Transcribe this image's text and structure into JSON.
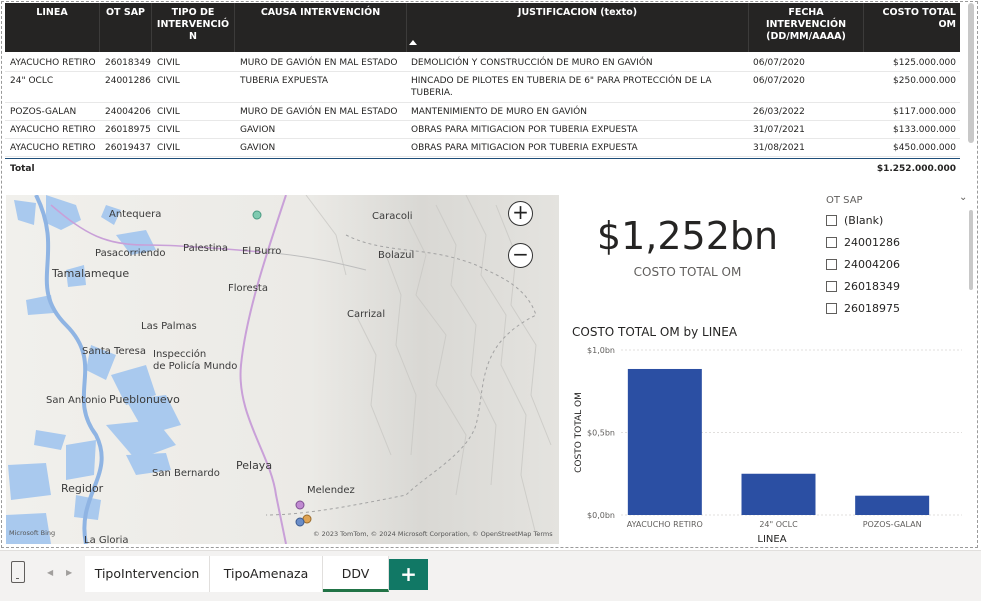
{
  "table": {
    "headers": [
      "LINEA",
      "OT SAP",
      "TIPO DE INTERVENCIÓN",
      "CAUSA INTERVENCIÓN",
      "JUSTIFICACION (texto)",
      "FECHA INTERVENCIÓN (DD/MM/AAAA)",
      "COSTO TOTAL OM"
    ],
    "header_tipo_lines": [
      "TIPO DE",
      "INTERVENCIÓ",
      "N"
    ],
    "header_fecha_lines": [
      "FECHA",
      "INTERVENCIÓN",
      "(DD/MM/AAAA)"
    ],
    "rows": [
      {
        "linea": "AYACUCHO RETIRO",
        "ot": "26018349",
        "tipo": "CIVIL",
        "causa": "MURO DE GAVIÓN EN MAL ESTADO",
        "just": "DEMOLICIÓN Y CONSTRUCCIÓN DE MURO EN GAVIÓN",
        "fecha": "06/07/2020",
        "costo": "$125.000.000"
      },
      {
        "linea": "24\" OCLC",
        "ot": "24001286",
        "tipo": "CIVIL",
        "causa": "TUBERIA EXPUESTA",
        "just": "HINCADO DE PILOTES EN TUBERIA DE 6\" PARA PROTECCIÓN DE LA TUBERIA.",
        "fecha": "06/07/2020",
        "costo": "$250.000.000"
      },
      {
        "linea": "POZOS-GALAN",
        "ot": "24004206",
        "tipo": "CIVIL",
        "causa": "MURO DE GAVIÓN EN MAL ESTADO",
        "just": "MANTENIMIENTO DE MURO EN GAVIÓN",
        "fecha": "26/03/2022",
        "costo": "$117.000.000"
      },
      {
        "linea": "AYACUCHO RETIRO",
        "ot": "26018975",
        "tipo": "CIVIL",
        "causa": "GAVION",
        "just": "OBRAS PARA MITIGACION POR TUBERIA EXPUESTA",
        "fecha": "31/07/2021",
        "costo": "$133.000.000"
      },
      {
        "linea": "AYACUCHO RETIRO",
        "ot": "26019437",
        "tipo": "CIVIL",
        "causa": "GAVION",
        "just": "OBRAS PARA MITIGACION POR TUBERIA EXPUESTA",
        "fecha": "31/08/2021",
        "costo": "$450.000.000"
      }
    ],
    "total_label": "Total",
    "total_value": "$1.252.000.000"
  },
  "map": {
    "labels": [
      "Antequera",
      "Caracoli",
      "Pasacorriendo",
      "Palestina",
      "El Burro",
      "Bolazul",
      "Tamalameque",
      "Floresta",
      "Carrizal",
      "Las Palmas",
      "Santa Teresa",
      "Inspección",
      "de Policía Mundo",
      "San Antonio",
      "Pueblonuevo",
      "San Bernardo",
      "Pelaya",
      "Regidor",
      "Melendez",
      "La Gloria"
    ],
    "zoom_in": "+",
    "zoom_out": "−",
    "credits": "© 2023 TomTom, © 2024 Microsoft Corporation, © OpenStreetMap   Terms",
    "logo": "Microsoft Bing"
  },
  "card": {
    "value": "$1,252bn",
    "label": "COSTO TOTAL OM"
  },
  "slicer": {
    "title": "OT SAP",
    "items": [
      "(Blank)",
      "24001286",
      "24004206",
      "26018349",
      "26018975"
    ]
  },
  "chart_data": {
    "type": "bar",
    "title": "COSTO TOTAL OM by LINEA",
    "xlabel": "LINEA",
    "ylabel": "COSTO TOTAL OM",
    "categories": [
      "AYACUCHO RETIRO",
      "24\" OCLC",
      "POZOS-GALAN"
    ],
    "values": [
      0.885,
      0.25,
      0.117
    ],
    "unit": "bn",
    "ylim": [
      0,
      1.0
    ],
    "yticks": [
      "$0,0bn",
      "$0,5bn",
      "$1,0bn"
    ],
    "color": "#2b4fa3",
    "grid": true
  },
  "tabs": {
    "items": [
      "TipoIntervencion",
      "TipoAmenaza",
      "DDV"
    ],
    "active": "DDV",
    "add_label": "+"
  },
  "colors": {
    "header_bg": "#252423",
    "bar": "#2b4fa3",
    "tab_accent": "#117865"
  }
}
